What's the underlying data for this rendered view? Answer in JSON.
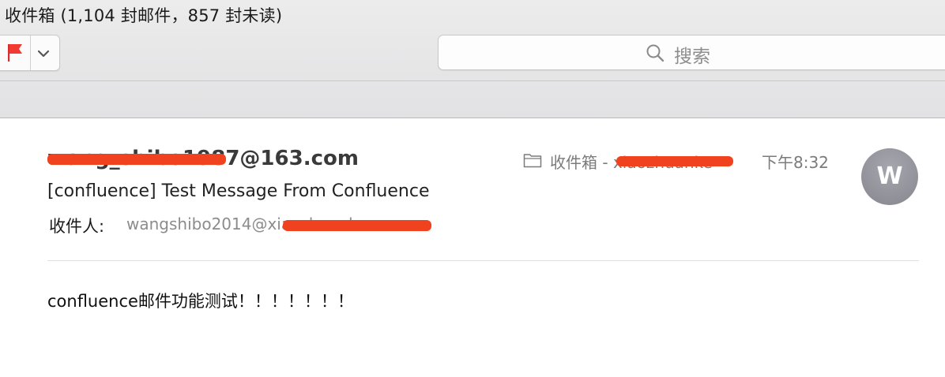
{
  "window": {
    "title": "收件箱 (1,104 封邮件，857 封未读)"
  },
  "toolbar": {
    "flag_icon": "flag-icon",
    "flag_color": "#f23a34",
    "flag_menu_icon": "chevron-down-icon",
    "search": {
      "icon": "search-icon",
      "placeholder": "搜索"
    }
  },
  "message": {
    "sender": "wang_shibo1987@163.com",
    "subject": "[confluence] Test Message From Confluence",
    "recipient_label": "收件人:",
    "recipient": "wangshibo2014@xiaozhuanke.com",
    "mailbox_label": "收件箱 - ",
    "mailbox_account": "xiaozhuanke",
    "time": "下午8:32",
    "avatar_initial": "W",
    "avatar_color": "#93939b",
    "body": "confluence邮件功能测试！！！！！！！",
    "redaction_color": "#f0421e"
  }
}
